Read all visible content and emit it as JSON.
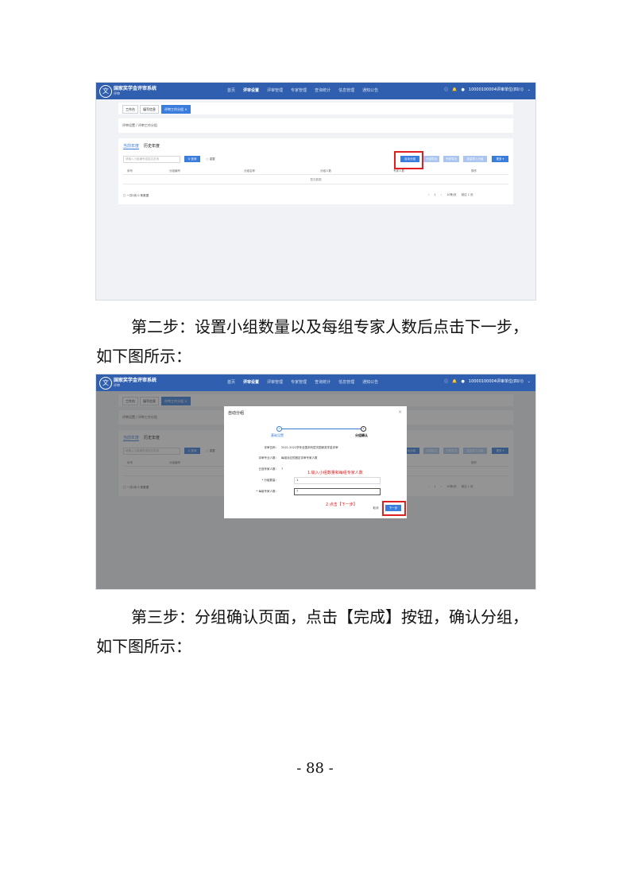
{
  "app": {
    "title": "国家奖学金评审系统",
    "subtitle": "评审",
    "logo": "文",
    "nav": [
      "首页",
      "评审设置",
      "评审管理",
      "专家管理",
      "查询统计",
      "信息管理",
      "通知公告"
    ],
    "user": "10000100004评审单位(四川)"
  },
  "shot1": {
    "tabs": [
      "工作台",
      "填写信息",
      "评审工作分组 ×"
    ],
    "breadcrumb": "评审设置 / 评审工作分组",
    "subtabs": [
      "当前年度",
      "历史年度"
    ],
    "search_placeholder": "请输入小组编号或姓名查询",
    "search_btn": "Q 查询",
    "reset_btn": "○ 重置",
    "toolbar": [
      "自动分组",
      "分组导出",
      "专家导出",
      "批量导入分组",
      "更多 ▾"
    ],
    "columns": [
      "序号",
      "分组编号",
      "分组名称",
      "分组人数",
      "专家人数",
      "操作"
    ],
    "empty_text": "暂无数据",
    "footer": "□ 一共0页 0 条数据",
    "pager": [
      "‹",
      "1",
      "›",
      "10条/页",
      "前往 1 页"
    ]
  },
  "paragraph1": {
    "line1": "第二步：设置小组数量以及每组专家人数后点击下一步，",
    "line2": "如下图所示："
  },
  "shot2": {
    "dialog_title": "自动分组",
    "close": "×",
    "steps": [
      {
        "num": "1",
        "label": "基础设置"
      },
      {
        "num": "2",
        "label": "分组确认"
      }
    ],
    "fields": [
      {
        "label": "评审名称：",
        "value": "2021-2022学年全国本科层次国家奖学金评审"
      },
      {
        "label": "评审专业人数：",
        "value": "每组对应的固定评审专家人数"
      },
      {
        "label": "已选专家人数：",
        "value": "7"
      },
      {
        "label": "* 分组数量：",
        "value": "1"
      },
      {
        "label": "* 每组专家人数：",
        "value": "7"
      }
    ],
    "annotation1": "1.输入小组数量和每组专家人数",
    "annotation2": "2.点击【下一步】",
    "cancel_btn": "取消",
    "next_btn": "下一步"
  },
  "paragraph2": {
    "line1": "第三步：分组确认页面，点击【完成】按钮，确认分组，",
    "line2": "如下图所示："
  },
  "page_number": "- 88 -",
  "colors": {
    "brand_blue": "#2f5fae",
    "accent_blue": "#3b7ddd",
    "highlight_red": "#e02020"
  }
}
